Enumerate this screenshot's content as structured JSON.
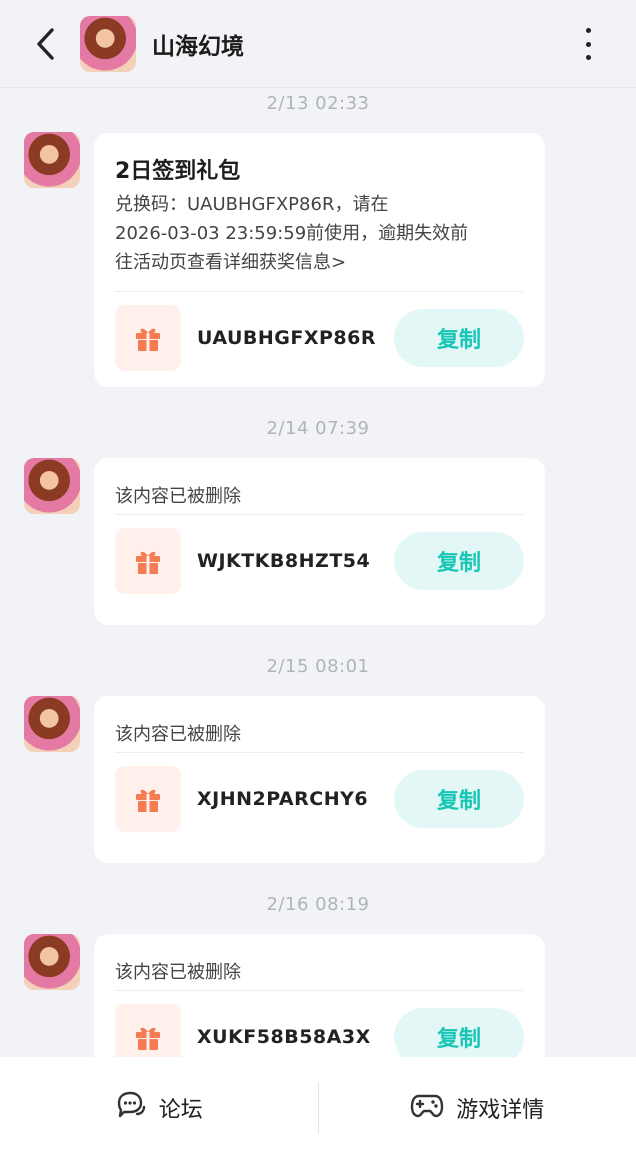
{
  "header": {
    "title": "山海幻境",
    "back_icon": "chevron-left-icon",
    "more_icon": "more-vertical-icon"
  },
  "messages": [
    {
      "timestamp": "2/13  02:33",
      "title": "2日签到礼包",
      "body_lines": [
        "兑换码：UAUBHGFXP86R，请在",
        "2026-03-03 23:59:59前使用，逾期失效前",
        "往活动页查看详细获奖信息>"
      ],
      "code": "UAUBHGFXP86R",
      "copy_label": "复制"
    },
    {
      "timestamp": "2/14  07:39",
      "deleted_text": "该内容已被删除",
      "code": "WJKTKB8HZT54",
      "copy_label": "复制"
    },
    {
      "timestamp": "2/15  08:01",
      "deleted_text": "该内容已被删除",
      "code": "XJHN2PARCHY6",
      "copy_label": "复制"
    },
    {
      "timestamp": "2/16  08:19",
      "deleted_text": "该内容已被删除",
      "code": "XUKF58B58A3X",
      "copy_label": "复制"
    }
  ],
  "bottom_bar": {
    "forum_label": "论坛",
    "forum_icon": "chat-bubble-icon",
    "details_label": "游戏详情",
    "details_icon": "gamepad-icon"
  },
  "colors": {
    "accent": "#16c7b5",
    "copy_bg": "#e3f8f6",
    "gift": "#f47b52",
    "gift_bg": "#fff0eb"
  }
}
